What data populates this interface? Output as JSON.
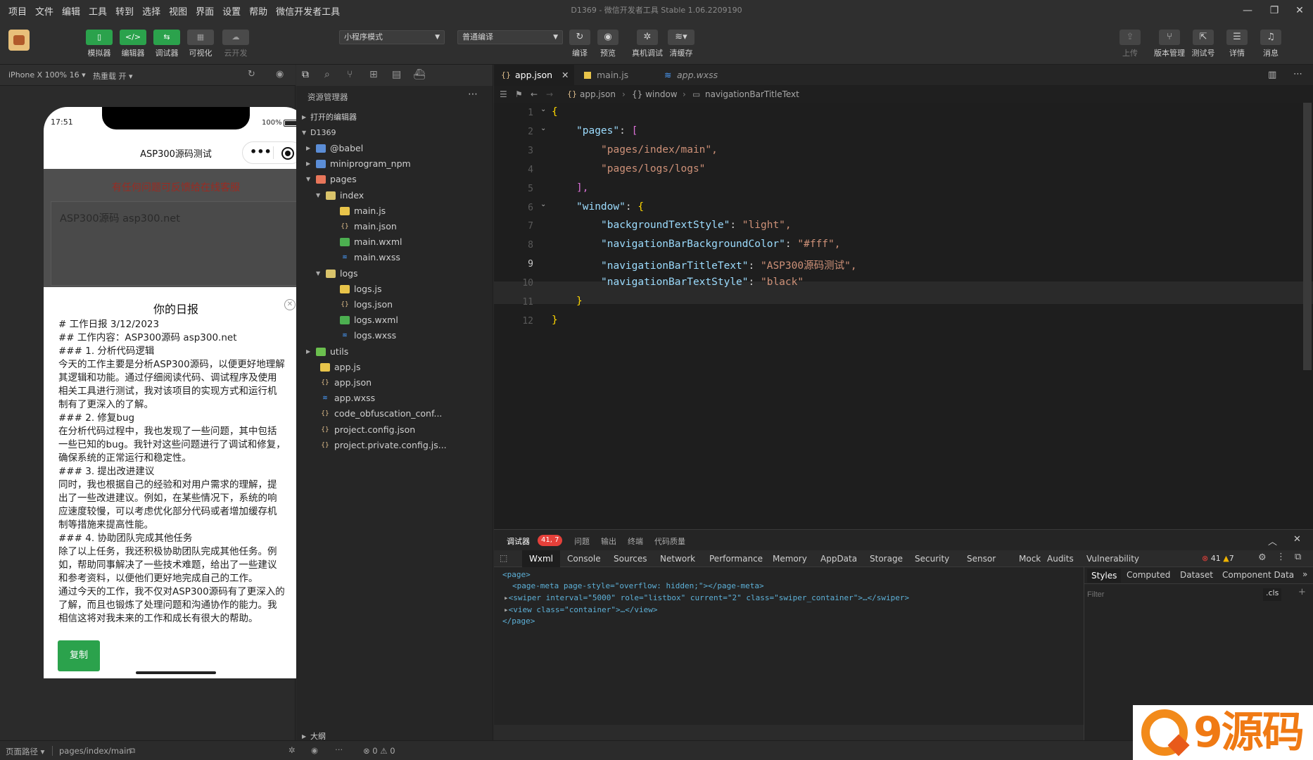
{
  "menu": {
    "items": [
      "项目",
      "文件",
      "编辑",
      "工具",
      "转到",
      "选择",
      "视图",
      "界面",
      "设置",
      "帮助",
      "微信开发者工具"
    ]
  },
  "window_title": "D1369 - 微信开发者工具 Stable 1.06.2209190",
  "toolbar": {
    "left_buttons": [
      {
        "label": "模拟器"
      },
      {
        "label": "编辑器"
      },
      {
        "label": "调试器"
      },
      {
        "label": "可视化"
      },
      {
        "label": "云开发"
      }
    ],
    "mode_select": "小程序模式",
    "compile_select": "普通编译",
    "mid_buttons": [
      {
        "label": "编译"
      },
      {
        "label": "预览"
      },
      {
        "label": "真机调试"
      },
      {
        "label": "清缓存"
      }
    ],
    "right_buttons": [
      {
        "label": "上传"
      },
      {
        "label": "版本管理"
      },
      {
        "label": "测试号"
      },
      {
        "label": "详情"
      },
      {
        "label": "消息"
      }
    ]
  },
  "simulator": {
    "device": "iPhone X 100% 16",
    "hot_reload": "热重载 开",
    "time": "17:51",
    "battery": "100%",
    "nav_title": "ASP300源码测试",
    "notice": "有任何问题可反馈给在线客服",
    "input_text": "ASP300源码 asp300.net",
    "sheet_title": "你的日报",
    "report_lines": [
      "# 工作日报 3/12/2023",
      "## 工作内容：ASP300源码 asp300.net",
      "### 1. 分析代码逻辑",
      "今天的工作主要是分析ASP300源码，以便更好地理解",
      "其逻辑和功能。通过仔细阅读代码、调试程序及使用",
      "相关工具进行测试，我对该项目的实现方式和运行机",
      "制有了更深入的了解。",
      "### 2. 修复bug",
      "在分析代码过程中，我也发现了一些问题，其中包括",
      "一些已知的bug。我针对这些问题进行了调试和修复，",
      "确保系统的正常运行和稳定性。",
      "### 3. 提出改进建议",
      "同时，我也根据自己的经验和对用户需求的理解，提",
      "出了一些改进建议。例如，在某些情况下，系统的响",
      "应速度较慢，可以考虑优化部分代码或者增加缓存机",
      "制等措施来提高性能。",
      "### 4. 协助团队完成其他任务",
      "除了以上任务，我还积极协助团队完成其他任务。例",
      "如，帮助同事解决了一些技术难题，给出了一些建议",
      "和参考资料，以便他们更好地完成自己的工作。",
      "通过今天的工作，我不仅对ASP300源码有了更深入的",
      "了解，而且也锻炼了处理问题和沟通协作的能力。我",
      "相信这将对我未来的工作和成长有很大的帮助。"
    ],
    "copy_button": "复制"
  },
  "explorer": {
    "title": "资源管理器",
    "open_editors": "打开的编辑器",
    "project": "D1369",
    "items": [
      {
        "name": "@babel",
        "type": "folder",
        "depth": 1,
        "icon": "folder-icon"
      },
      {
        "name": "miniprogram_npm",
        "type": "folder",
        "depth": 1,
        "icon": "folder-icon"
      },
      {
        "name": "pages",
        "type": "folder",
        "depth": 1,
        "icon": "folder-open-icon"
      },
      {
        "name": "index",
        "type": "folder",
        "depth": 2,
        "icon": "folder-open-icon"
      },
      {
        "name": "main.js",
        "type": "js",
        "depth": 3,
        "icon": "js-file-icon"
      },
      {
        "name": "main.json",
        "type": "json",
        "depth": 3,
        "icon": "json-file-icon"
      },
      {
        "name": "main.wxml",
        "type": "wxml",
        "depth": 3,
        "icon": "wxml-file-icon"
      },
      {
        "name": "main.wxss",
        "type": "wxss",
        "depth": 3,
        "icon": "wxss-file-icon"
      },
      {
        "name": "logs",
        "type": "folder",
        "depth": 2,
        "icon": "folder-open-icon"
      },
      {
        "name": "logs.js",
        "type": "js",
        "depth": 3,
        "icon": "js-file-icon"
      },
      {
        "name": "logs.json",
        "type": "json",
        "depth": 3,
        "icon": "json-file-icon"
      },
      {
        "name": "logs.wxml",
        "type": "wxml",
        "depth": 3,
        "icon": "wxml-file-icon"
      },
      {
        "name": "logs.wxss",
        "type": "wxss",
        "depth": 3,
        "icon": "wxss-file-icon"
      },
      {
        "name": "utils",
        "type": "folder",
        "depth": 1,
        "icon": "folder-icon"
      },
      {
        "name": "app.js",
        "type": "js",
        "depth": 1,
        "icon": "js-file-icon"
      },
      {
        "name": "app.json",
        "type": "json",
        "depth": 1,
        "icon": "json-file-icon"
      },
      {
        "name": "app.wxss",
        "type": "wxss",
        "depth": 1,
        "icon": "wxss-file-icon"
      },
      {
        "name": "code_obfuscation_conf...",
        "type": "json",
        "depth": 1,
        "icon": "json-file-icon"
      },
      {
        "name": "project.config.json",
        "type": "json",
        "depth": 1,
        "icon": "json-file-icon"
      },
      {
        "name": "project.private.config.js...",
        "type": "json",
        "depth": 1,
        "icon": "json-file-icon"
      }
    ],
    "outline": "大纲",
    "problems": "⊗ 0 ⚠ 0"
  },
  "editor": {
    "tabs": [
      {
        "label": "app.json",
        "active": true
      },
      {
        "label": "main.js",
        "active": false
      },
      {
        "label": "app.wxss",
        "active": false
      }
    ],
    "breadcrumb": [
      "app.json",
      "{} window",
      "navigationBarTitleText"
    ],
    "line_numbers": [
      "1",
      "2",
      "3",
      "4",
      "5",
      "6",
      "7",
      "8",
      "9",
      "10",
      "11",
      "12"
    ],
    "lines": [
      "{",
      "\"pages\": [",
      "\"pages/index/main\",",
      "\"pages/logs/logs\"",
      "],",
      "\"window\": {",
      "\"backgroundTextStyle\": \"light\",",
      "\"navigationBarBackgroundColor\": \"#fff\",",
      "\"navigationBarTitleText\": \"ASP300源码测试\",",
      "\"navigationBarTextStyle\": \"black\"",
      "}",
      "}"
    ]
  },
  "devtools": {
    "top_tabs": [
      "调试器",
      "问题",
      "输出",
      "终端",
      "代码质量"
    ],
    "badge": "41, 7",
    "tabs": [
      "Wxml",
      "Console",
      "Sources",
      "Network",
      "Performance",
      "Memory",
      "AppData",
      "Storage",
      "Security",
      "Sensor",
      "Mock",
      "Audits",
      "Vulnerability"
    ],
    "errors": "41",
    "warnings": "7",
    "dom_lines": [
      "<page>",
      "<page-meta page-style=\"overflow: hidden;\"></page-meta>",
      "<swiper interval=\"5000\" role=\"listbox\" current=\"2\" class=\"swiper_container\">…</swiper>",
      "<view class=\"container\">…</view>",
      "</page>"
    ],
    "style_tabs": [
      "Styles",
      "Computed",
      "Dataset",
      "Component Data"
    ],
    "filter_placeholder": "Filter",
    "cls": ".cls"
  },
  "status": {
    "path_label": "页面路径",
    "path": "pages/index/main"
  },
  "watermark": {
    "text": "9源码"
  },
  "colors": {
    "accent_green": "#2ba24c",
    "error_red": "#e5403a",
    "notice_red": "#c0392b"
  }
}
